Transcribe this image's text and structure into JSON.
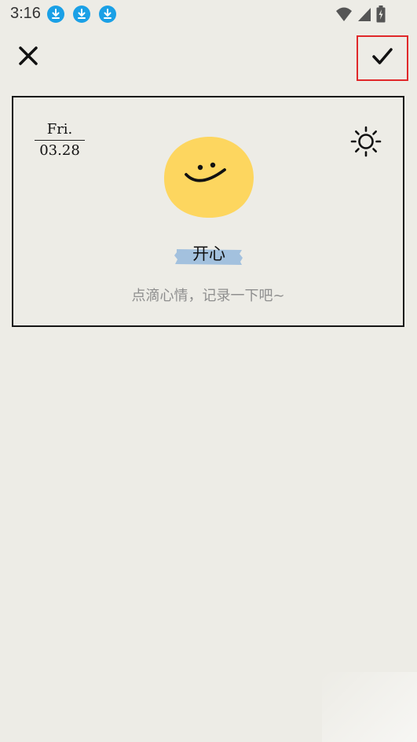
{
  "status_bar": {
    "time": "3:16",
    "notification_icons": [
      "download-icon",
      "download-icon",
      "download-icon"
    ],
    "system_icons": [
      "wifi-icon",
      "cell-signal-icon",
      "battery-charging-icon"
    ]
  },
  "toolbar": {
    "close_icon": "close-icon",
    "confirm_icon": "check-icon",
    "highlight_color": "#e0282a"
  },
  "entry": {
    "date": {
      "weekday": "Fri.",
      "day": "03.28"
    },
    "weather_icon": "sun-icon",
    "mood": {
      "label": "开心",
      "face_color": "#fdd65f",
      "tape_color": "#a3c1de"
    },
    "note_placeholder": "点滴心情，记录一下吧~"
  },
  "colors": {
    "background": "#edece6",
    "card_border": "#151515",
    "placeholder_text": "#8e8e8e",
    "notification_badge": "#1aa0e6"
  }
}
